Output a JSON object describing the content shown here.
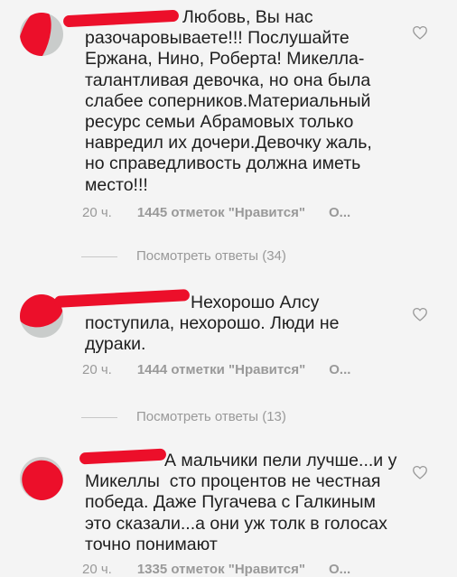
{
  "comments": [
    {
      "username": "",
      "text": "Любовь, Вы нас\nразочаровываете!!! Послушайте\nЕржана, Нино, Роберта! Микелла-\nталантливая девочка, но она была\nслабее соперников.Материальный\nресурс семьи Абрамовых только\nнавредил их дочери.Девочку жаль,\nно справедливость должна иметь\nместо!!!",
      "time": "20 ч.",
      "likes": "1445 отметок \"Нравится\"",
      "more": "О...",
      "replies": "Посмотреть ответы (34)"
    },
    {
      "username": "",
      "text": "Нехорошо Алсу\nпоступила, нехорошо. Люди не\nдураки.",
      "time": "20 ч.",
      "likes": "1444 отметки \"Нравится\"",
      "more": "О...",
      "replies": "Посмотреть ответы (13)"
    },
    {
      "username": "",
      "text": "А мальчики пели лучше...и у\nМикеллы  сто процентов не честная\nпобеда. Даже Пугачева с Галкиным\nэто сказали...а они уж толк в голосах\nточно понимают",
      "time": "20 ч.",
      "likes": "1335 отметок \"Нравится\"",
      "more": "О..."
    }
  ],
  "colors": {
    "redaction": "#ec0f2a",
    "meta": "#999999",
    "text": "#1e1e1e"
  },
  "icons": {
    "like": "heart-icon"
  }
}
